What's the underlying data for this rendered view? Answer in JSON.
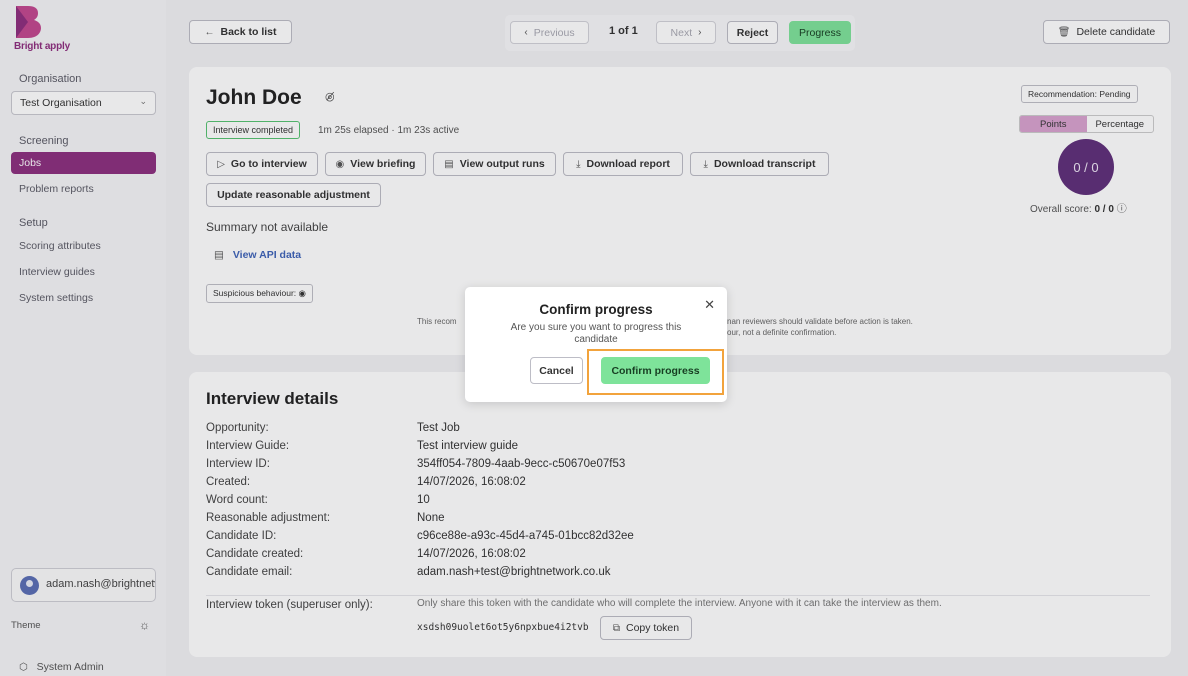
{
  "sidebar": {
    "brand": "Bright apply",
    "organisation_heading": "Organisation",
    "organisation_selected": "Test Organisation",
    "screening_heading": "Screening",
    "screening_items": [
      "Jobs",
      "Problem reports"
    ],
    "setup_heading": "Setup",
    "setup_items": [
      "Scoring attributes",
      "Interview guides",
      "System settings"
    ],
    "user": "adam.nash@brightnetwork.co.uk",
    "theme_label": "Theme",
    "system_admin": "System Admin"
  },
  "topbar": {
    "back": "Back to list",
    "previous": "Previous",
    "pager": "1 of 1",
    "next": "Next",
    "reject": "Reject",
    "progress": "Progress",
    "delete": "Delete candidate"
  },
  "candidate": {
    "name": "John Doe",
    "status_badge": "Interview completed",
    "elapsed": "1m 25s elapsed · 1m 23s active",
    "actions": [
      "Go to interview",
      "View briefing",
      "View output runs",
      "Download report",
      "Download transcript"
    ],
    "update_adjustment": "Update reasonable adjustment",
    "summary": "Summary not available",
    "api_link": "View API data",
    "suspicious": "Suspicious behaviour:",
    "disclaimer_left": "This recom",
    "disclaimer_right_1": "nan reviewers should validate before action is taken.",
    "disclaimer_right_2": "our, not a definite confirmation."
  },
  "score": {
    "recommendation": "Recommendation: Pending",
    "tab_points": "Points",
    "tab_percentage": "Percentage",
    "circle": "0 / 0",
    "overall_label": "Overall score:",
    "overall_value": "0 / 0"
  },
  "details": {
    "title": "Interview details",
    "rows": [
      {
        "label": "Opportunity:",
        "value": "Test Job"
      },
      {
        "label": "Interview Guide:",
        "value": "Test interview guide"
      },
      {
        "label": "Interview ID:",
        "value": "354ff054-7809-4aab-9ecc-c50670e07f53"
      },
      {
        "label": "Created:",
        "value": "14/07/2026, 16:08:02"
      },
      {
        "label": "Word count:",
        "value": "10"
      },
      {
        "label": "Reasonable adjustment:",
        "value": "None"
      },
      {
        "label": "Candidate ID:",
        "value": "c96ce88e-a93c-45d4-a745-01bcc82d32ee"
      },
      {
        "label": "Candidate created:",
        "value": "14/07/2026, 16:08:02"
      },
      {
        "label": "Candidate email:",
        "value": "adam.nash+test@brightnetwork.co.uk"
      }
    ],
    "token_label": "Interview token (superuser only):",
    "token_note": "Only share this token with the candidate who will complete the interview. Anyone with it can take the interview as them.",
    "token": "xsdsh09uolet6ot5y6npxbue4i2tvb",
    "copy_token": "Copy token"
  },
  "modal": {
    "title": "Confirm progress",
    "text": "Are you sure you want to progress this candidate",
    "cancel": "Cancel",
    "confirm": "Confirm progress"
  },
  "colors": {
    "brand": "#8c2f7e",
    "progress_green": "#7ee39a",
    "score_circle": "#5f2f7a",
    "focus_ring": "#f2a33c"
  }
}
